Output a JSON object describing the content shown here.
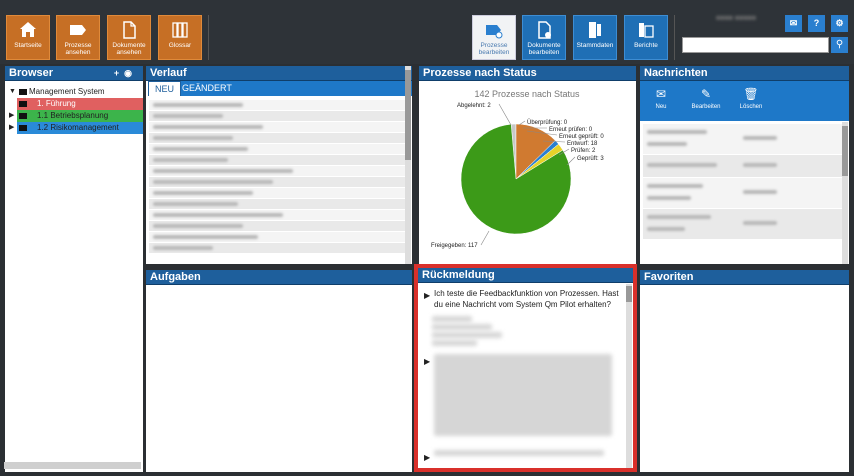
{
  "toolbar": {
    "left_buttons": [
      {
        "label": "Startseite",
        "icon": "home-icon"
      },
      {
        "label": "Prozesse ansehen",
        "icon": "tag-icon"
      },
      {
        "label": "Dokumente ansehen",
        "icon": "document-icon"
      },
      {
        "label": "Glossar",
        "icon": "book-icon"
      }
    ],
    "right_buttons": [
      {
        "label": "Prozesse bearbeiten",
        "icon": "process-edit-icon",
        "active": true
      },
      {
        "label": "Dokumente bearbeiten",
        "icon": "document-edit-icon"
      },
      {
        "label": "Stammdaten",
        "icon": "master-data-icon"
      },
      {
        "label": "Berichte",
        "icon": "reports-icon"
      }
    ],
    "small_buttons": [
      {
        "label": "✉",
        "icon": "mail-icon"
      },
      {
        "label": "?",
        "icon": "help-icon"
      },
      {
        "label": "⚙",
        "icon": "gear-icon"
      }
    ],
    "search_placeholder": ""
  },
  "browser": {
    "title": "Browser",
    "tree": [
      {
        "label": "Management System",
        "level": 0,
        "style": "none"
      },
      {
        "label": "1. Führung",
        "level": 1,
        "style": "red"
      },
      {
        "label": "1.1 Betriebsplanung",
        "level": 1,
        "style": "green"
      },
      {
        "label": "1.2 Risikomanagement",
        "level": 1,
        "style": "blue"
      }
    ]
  },
  "verlauf": {
    "title": "Verlauf",
    "tabs": [
      "NEU",
      "GEÄNDERT"
    ]
  },
  "status": {
    "title": "Prozesse nach Status"
  },
  "chart_data": {
    "type": "pie",
    "title": "142 Prozesse nach Status",
    "categories": [
      "Freigegeben",
      "Abgelehnt",
      "Entwurf",
      "Überprüfung",
      "Erneut prüfen",
      "Erneut geprüft",
      "Prüfen",
      "Geprüft"
    ],
    "values": [
      117,
      2,
      18,
      0,
      0,
      0,
      2,
      3
    ],
    "labels": [
      "Freigegeben: 117",
      "Abgelehnt: 2",
      "Entwurf: 18",
      "Überprüfung: 0",
      "Erneut prüfen: 0",
      "Erneut geprüft: 0",
      "Prüfen: 2",
      "Geprüft: 3"
    ],
    "colors": [
      "#3c9a18",
      "#c8c8c8",
      "#d07a30",
      "#999999",
      "#aaaaaa",
      "#bbbbbb",
      "#2a7fcf",
      "#e6d22a"
    ]
  },
  "nachrichten": {
    "title": "Nachrichten",
    "actions": [
      {
        "label": "Neu",
        "icon": "new-message-icon"
      },
      {
        "label": "Bearbeiten",
        "icon": "pencil-icon"
      },
      {
        "label": "Löschen",
        "icon": "trash-icon"
      }
    ]
  },
  "aufgaben": {
    "title": "Aufgaben"
  },
  "rueckmeldung": {
    "title": "Rückmeldung",
    "first_message": "Ich teste die Feedbackfunktion von Prozessen. Hast du eine Nachricht vom System Qm Pilot erhalten?"
  },
  "favoriten": {
    "title": "Favoriten"
  }
}
